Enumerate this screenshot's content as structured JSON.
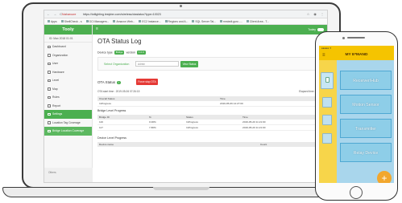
{
  "browser": {
    "nav_glyphs": "← → C ⌂",
    "secure_label": "Not secure",
    "url": "https://iotlighting.lestpbe.com/wireless/otastatus?type=10023",
    "ext_glyphs": "☆ ◉ ⋮",
    "bookmarks": [
      "Apps",
      "ShellCheck - s",
      "GCI Managem...",
      "Amazon Web...",
      "EC2 Instance...",
      "Regions and A...",
      "SQL Server Tal...",
      "rmstedt.guru -...",
      "Client Area - T..."
    ]
  },
  "sidebar": {
    "brand": "Tooly",
    "user": "ID: Max 2018 01:01",
    "items": [
      {
        "label": "Dashboard",
        "icon": "dashboard-icon"
      },
      {
        "label": "Organization",
        "icon": "organization-icon"
      },
      {
        "label": "User",
        "icon": "user-icon"
      },
      {
        "label": "Hardware",
        "icon": "hardware-icon"
      },
      {
        "label": "Level",
        "icon": "level-icon"
      },
      {
        "label": "Map",
        "icon": "map-icon"
      },
      {
        "label": "Rules",
        "icon": "rules-icon"
      },
      {
        "label": "Report",
        "icon": "report-icon"
      },
      {
        "label": "Settings",
        "icon": "settings-icon"
      },
      {
        "label": "Location Tag Coverage",
        "icon": "location-tag-icon"
      },
      {
        "label": "Bridge Location Coverage",
        "icon": "bridge-location-icon"
      }
    ],
    "footer": "Others"
  },
  "topbar": {
    "menu_glyph": "≡",
    "user": "Tooley"
  },
  "content": {
    "title": "OTA Status Log",
    "device_type_label": "Device type",
    "device_type_tag": "Bridge",
    "version_label": "version",
    "version_tag": "1.0.0",
    "org_label": "Select Organization",
    "org_select_value": "Admin",
    "view_button": "View Status",
    "ota_status_label": "OTA Status",
    "force_button": "Force stop OTA",
    "start_time": "OTA start time : 2019-05-06 07:26:15",
    "elapsed_time": "Elapsed time : 00 : 06",
    "overall": {
      "headers": [
        "Overall Status",
        "Time"
      ],
      "rows": [
        [
          "InProgress",
          "2019-05-06 14:27:00"
        ]
      ]
    },
    "bridge_title": "Bridge Level Progress",
    "bridge": {
      "headers": [
        "Bridge ID",
        "%",
        "Status",
        "Time"
      ],
      "rows": [
        [
          "116",
          "0.00%",
          "InProgress",
          "2019-05-20 11:21:00"
        ],
        [
          "117",
          "7.80%",
          "InProgress",
          "2019-05-20 11:21:00"
        ]
      ]
    },
    "device_title": "Device Level Progress",
    "device": {
      "headers": [
        "Device name",
        "Count"
      ],
      "rows": []
    }
  },
  "phone": {
    "status": "●●●●● ✦",
    "title": "MY E*MAND",
    "menu_glyph": "≡",
    "cards": [
      "Receiver/Hub",
      "Motion Sensor",
      "Transmitter",
      "Relay Device"
    ],
    "fab": "+"
  }
}
